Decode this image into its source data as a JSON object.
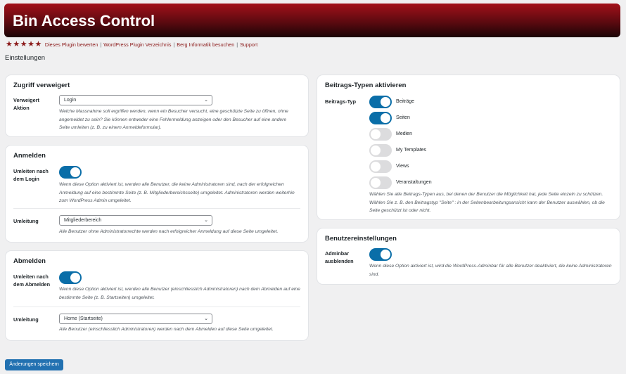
{
  "header": {
    "title": "Bin Access Control"
  },
  "links": {
    "rate": "Dieses Plugin bewerten",
    "directory": "WordPress Plugin Verzeichnis",
    "visit": "Berg Informatik besuchen",
    "support": "Support",
    "separator": "|"
  },
  "page_title": "Einstellungen",
  "access_denied": {
    "title": "Zugriff verweigert",
    "action_label": "Verweigert Aktion",
    "action_value": "Login",
    "action_desc": "Welche Massnahme soll ergriffen werden, wenn ein Besucher versucht, eine geschützte Seite zu öffnen, ohne angemeldet zu sein? Sie können entweder eine Fehlermeldung anzeigen oder den Besucher auf eine andere Seite umleiten (z. B. zu einem Anmeldeformular)."
  },
  "login": {
    "title": "Anmelden",
    "redirect_label": "Umleiten nach dem Login",
    "redirect_desc": "Wenn diese Option aktiviert ist, werden alle Benutzer, die keine Administratoren sind, nach der erfolgreichen Anmeldung auf eine bestimmte Seite (z. B. Mitgliederbereichsseite) umgeleitet. Administratoren werden weiterhin zum WordPress Admin umgeleitet.",
    "target_label": "Umleitung",
    "target_value": "Mitgliederbereich",
    "target_desc": "Alle Benutzer ohne Administratorrechte werden nach erfolgreicher Anmeldung auf diese Seite umgeleitet."
  },
  "logout": {
    "title": "Abmelden",
    "redirect_label": "Umleiten nach dem Abmelden",
    "redirect_desc": "Wenn diese Option aktiviert ist, werden alle Benutzer (einschliesslich Administratoren) nach dem Abmelden auf eine bestimmte Seite (z. B. Startseiten) umgeleitet.",
    "target_label": "Umleitung",
    "target_value": "Home (Startseite)",
    "target_desc": "Alle Benutzer (einschliesslich Administratoren) werden nach dem Abmelden auf diese Seite umgeleitet."
  },
  "post_types": {
    "title": "Beitrags-Typen aktivieren",
    "label": "Beitrags-Typ",
    "items": [
      {
        "label": "Beiträge",
        "on": true
      },
      {
        "label": "Seiten",
        "on": true
      },
      {
        "label": "Medien",
        "on": false
      },
      {
        "label": "My Templates",
        "on": false
      },
      {
        "label": "Views",
        "on": false
      },
      {
        "label": "Veranstaltungen",
        "on": false
      }
    ],
    "desc": "Wählen Sie alle Beitrags-Typen aus, bei denen der Benutzer die Möglichkeit hat, jede Seite einzeln zu schützen. Wählen Sie z. B. den Beitragstyp \"Seite\" : in der Seitenbearbeitungsansicht kann der Benutzer auswählen, ob die Seite geschützt ist oder nicht."
  },
  "user_settings": {
    "title": "Benutzereinstellungen",
    "adminbar_label": "Adminbar ausblenden",
    "adminbar_desc": "Wenn diese Option aktiviert ist, wird die WordPress-Adminbar für alle Benutzer deaktiviert, die keine Administratoren sind."
  },
  "save_label": "Änderungen speichern",
  "colors": {
    "accent": "#0a6ea8",
    "brand": "#8b1a1a",
    "button": "#2271b1"
  }
}
